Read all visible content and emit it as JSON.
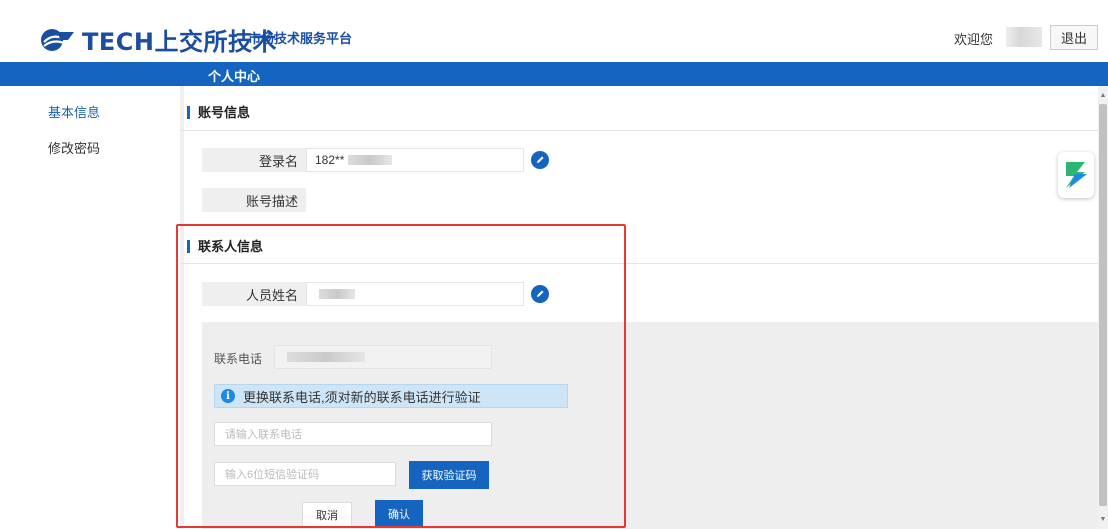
{
  "header": {
    "logo_text": "TECH上交所技术",
    "platform_name": "市场技术服务平台",
    "welcome": "欢迎您",
    "logout": "退出"
  },
  "navbar": {
    "title": "个人中心"
  },
  "sidebar": {
    "items": [
      {
        "label": "基本信息"
      },
      {
        "label": "修改密码"
      }
    ]
  },
  "account_section": {
    "title": "账号信息",
    "login_name_label": "登录名",
    "login_name_value": "182**",
    "description_label": "账号描述"
  },
  "contact_section": {
    "title": "联系人信息",
    "name_label": "人员姓名",
    "phone_label": "联系电话",
    "info_message": "更换联系电话,须对新的联系电话进行验证",
    "phone_input_placeholder": "请输入联系电话",
    "code_input_placeholder": "输入6位短信验证码",
    "get_code_button": "获取验证码",
    "cancel_button": "取消",
    "confirm_button": "确认"
  },
  "colors": {
    "brand": "#1564c0",
    "highlight": "#e53935",
    "info_bg": "#cde5f7"
  },
  "icons": [
    "logo-icon",
    "edit-icon",
    "info-icon",
    "float-widget-icon",
    "scroll-up-icon",
    "scroll-down-icon"
  ]
}
